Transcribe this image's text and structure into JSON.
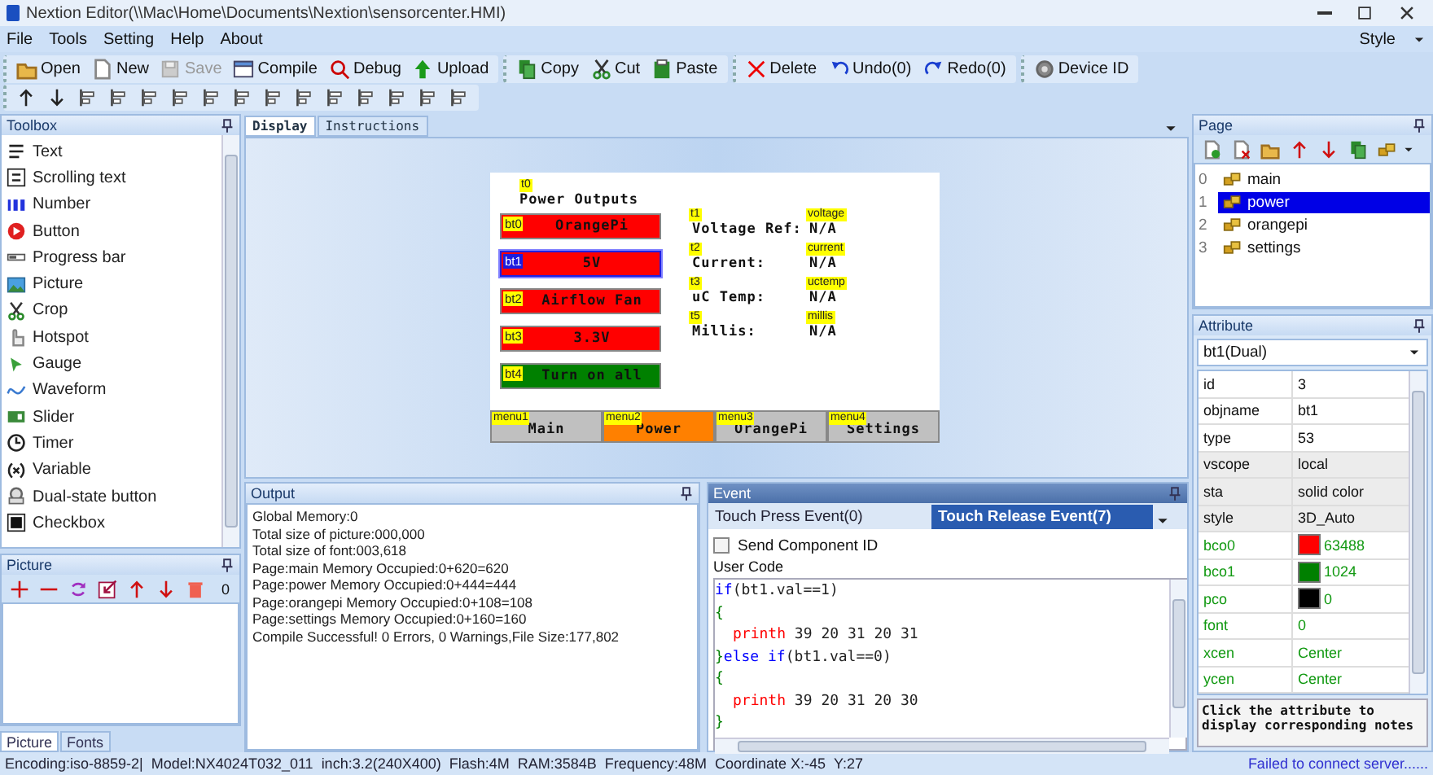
{
  "window": {
    "title": "Nextion Editor(\\\\Mac\\Home\\Documents\\Nextion\\sensorcenter.HMI)"
  },
  "menu": [
    "File",
    "Tools",
    "Setting",
    "Help",
    "About"
  ],
  "style_menu": "Style",
  "toolbar": [
    [
      {
        "label": "Open",
        "disabled": false
      },
      {
        "label": "New",
        "disabled": false
      },
      {
        "label": "Save",
        "disabled": true
      },
      {
        "label": "Compile",
        "disabled": false
      },
      {
        "label": "Debug",
        "disabled": false
      },
      {
        "label": "Upload",
        "disabled": false
      }
    ],
    [
      {
        "label": "Copy",
        "disabled": false
      },
      {
        "label": "Cut",
        "disabled": false
      },
      {
        "label": "Paste",
        "disabled": false
      }
    ],
    [
      {
        "label": "Delete",
        "disabled": false
      },
      {
        "label": "Undo(0)",
        "disabled": false
      },
      {
        "label": "Redo(0)",
        "disabled": false
      }
    ],
    [
      {
        "label": "Device ID",
        "disabled": false
      }
    ]
  ],
  "toolbox": {
    "title": "Toolbox",
    "items": [
      "Text",
      "Scrolling text",
      "Number",
      "Button",
      "Progress bar",
      "Picture",
      "Crop",
      "Hotspot",
      "Gauge",
      "Waveform",
      "Slider",
      "Timer",
      "Variable",
      "Dual-state button",
      "Checkbox"
    ]
  },
  "picture_panel": {
    "title": "Picture",
    "count": "0"
  },
  "left_tabs": [
    {
      "label": "Picture",
      "selected": true
    },
    {
      "label": "Fonts",
      "selected": false
    }
  ],
  "editor_tabs": [
    {
      "label": "Display",
      "selected": true
    },
    {
      "label": "Instructions",
      "selected": false
    }
  ],
  "display": {
    "title": {
      "tag": "t0",
      "text": "Power Outputs"
    },
    "buttons": [
      {
        "tag": "bt0",
        "label": "OrangePi",
        "color": "#ff0000",
        "selected": false
      },
      {
        "tag": "bt1",
        "label": "5V",
        "color": "#ff0000",
        "selected": true
      },
      {
        "tag": "bt2",
        "label": "Airflow Fan",
        "color": "#ff0000",
        "selected": false
      },
      {
        "tag": "bt3",
        "label": "3.3V",
        "color": "#ff0000",
        "selected": false
      },
      {
        "tag": "bt4",
        "label": "Turn on all",
        "color": "#008000",
        "selected": false
      }
    ],
    "fields": [
      {
        "tag": "t1",
        "label": "Voltage Ref:",
        "value_tag": "voltage",
        "value": "N/A"
      },
      {
        "tag": "t2",
        "label": "Current:",
        "value_tag": "current",
        "value": "N/A"
      },
      {
        "tag": "t3",
        "label": "uC Temp:",
        "value_tag": "uctemp",
        "value": "N/A"
      },
      {
        "tag": "t5",
        "label": "Millis:",
        "value_tag": "millis",
        "value": "N/A"
      }
    ],
    "menu": [
      {
        "tag": "menu1",
        "label": "Main",
        "color": "#c0c0c0"
      },
      {
        "tag": "menu2",
        "label": "Power",
        "color": "#ff8000"
      },
      {
        "tag": "menu3",
        "label": "OrangePi",
        "color": "#c0c0c0"
      },
      {
        "tag": "menu4",
        "label": "Settings",
        "color": "#c0c0c0"
      }
    ]
  },
  "output": {
    "title": "Output",
    "lines": [
      "Global Memory:0",
      "Total size of picture:000,000",
      "Total size of font:003,618",
      "Page:main Memory Occupied:0+620=620",
      "Page:power Memory Occupied:0+444=444",
      "Page:orangepi Memory Occupied:0+108=108",
      "Page:settings Memory Occupied:0+160=160",
      "Compile Successful! 0 Errors, 0 Warnings,File Size:177,802"
    ]
  },
  "event": {
    "title": "Event",
    "tabs": [
      {
        "label": "Touch Press Event(0)",
        "selected": false
      },
      {
        "label": "Touch Release Event(7)",
        "selected": true
      }
    ],
    "send_component_id": {
      "label": "Send Component ID",
      "checked": false
    },
    "code_label": "User Code",
    "code": [
      {
        "indented": false,
        "tokens": [
          {
            "kind": "keyword",
            "text": "if"
          },
          {
            "kind": "plain",
            "text": "(bt1.val==1)"
          }
        ]
      },
      {
        "indented": false,
        "tokens": [
          {
            "kind": "brace",
            "text": "{"
          }
        ]
      },
      {
        "indented": true,
        "tokens": [
          {
            "kind": "func",
            "text": "printh"
          },
          {
            "kind": "plain",
            "text": " 39 20 31 20 31"
          }
        ]
      },
      {
        "indented": false,
        "tokens": [
          {
            "kind": "brace",
            "text": "}"
          },
          {
            "kind": "keyword",
            "text": "else if"
          },
          {
            "kind": "plain",
            "text": "(bt1.val==0)"
          }
        ]
      },
      {
        "indented": false,
        "tokens": [
          {
            "kind": "brace",
            "text": "{"
          }
        ]
      },
      {
        "indented": true,
        "tokens": [
          {
            "kind": "func",
            "text": "printh"
          },
          {
            "kind": "plain",
            "text": " 39 20 31 20 30"
          }
        ]
      },
      {
        "indented": false,
        "tokens": [
          {
            "kind": "brace",
            "text": "}"
          }
        ]
      }
    ]
  },
  "page_panel": {
    "title": "Page",
    "pages": [
      {
        "index": "0",
        "name": "main",
        "selected": false
      },
      {
        "index": "1",
        "name": "power",
        "selected": true
      },
      {
        "index": "2",
        "name": "orangepi",
        "selected": false
      },
      {
        "index": "3",
        "name": "settings",
        "selected": false
      }
    ]
  },
  "attribute_panel": {
    "title": "Attribute",
    "component": "bt1(Dual)",
    "rows": [
      {
        "name": "id",
        "value": "3",
        "kind": "info"
      },
      {
        "name": "objname",
        "value": "bt1",
        "kind": "info"
      },
      {
        "name": "type",
        "value": "53",
        "kind": "info"
      },
      {
        "name": "vscope",
        "value": "local",
        "kind": "setting"
      },
      {
        "name": "sta",
        "value": "solid color",
        "kind": "setting"
      },
      {
        "name": "style",
        "value": "3D_Auto",
        "kind": "setting"
      },
      {
        "name": "bco0",
        "value": "63488",
        "kind": "editable",
        "color": "#ff0000"
      },
      {
        "name": "bco1",
        "value": "1024",
        "kind": "editable",
        "color": "#008000"
      },
      {
        "name": "pco",
        "value": "0",
        "kind": "editable",
        "color": "#000000"
      },
      {
        "name": "font",
        "value": "0",
        "kind": "editable"
      },
      {
        "name": "xcen",
        "value": "Center",
        "kind": "editable"
      },
      {
        "name": "ycen",
        "value": "Center",
        "kind": "editable"
      }
    ],
    "notes": "Click the attribute to display corresponding notes"
  },
  "status_bar": {
    "items": [
      "Encoding:iso-8859-2|",
      "Model:NX4024T032_011",
      "inch:3.2(240X400)",
      "Flash:4M",
      "RAM:3584B",
      "Frequency:48M",
      "Coordinate X:-45",
      "Y:27"
    ],
    "connection": "Failed to connect server......"
  }
}
